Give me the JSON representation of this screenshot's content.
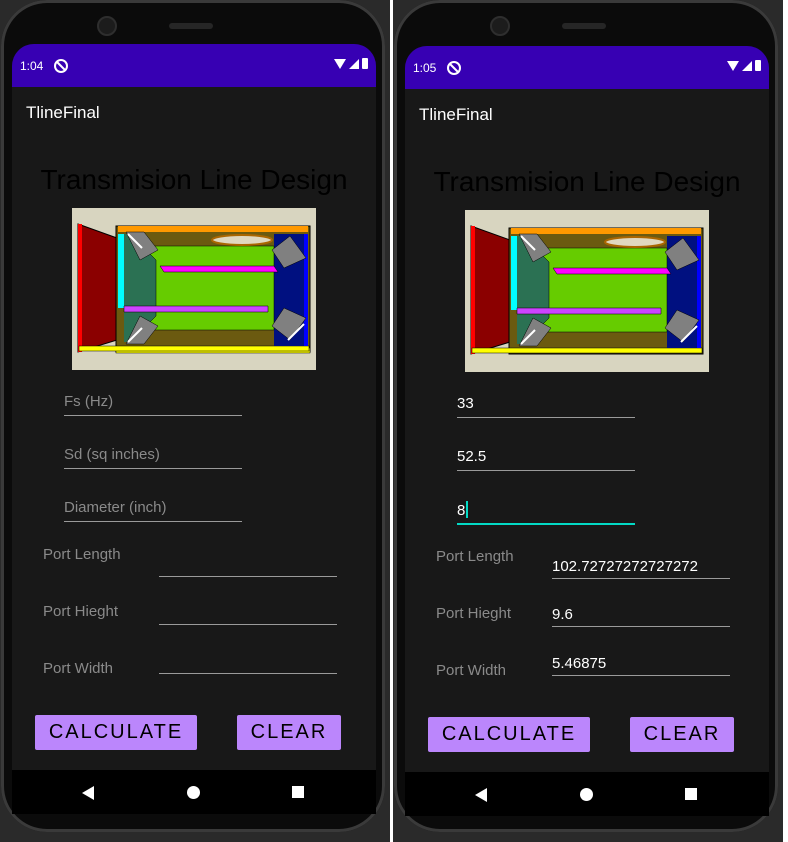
{
  "screens": [
    {
      "status_time": "1:04",
      "app_title": "TlineFinal",
      "heading": "Transmision Line Design",
      "inputs": {
        "fs": {
          "value": "",
          "placeholder": "Fs (Hz)"
        },
        "sd": {
          "value": "",
          "placeholder": "Sd (sq inches)"
        },
        "diameter": {
          "value": "",
          "placeholder": "Diameter (inch)"
        }
      },
      "outputs": {
        "port_length": {
          "label": "Port Length",
          "value": ""
        },
        "port_height": {
          "label": "Port Hieght",
          "value": ""
        },
        "port_width": {
          "label": "Port Width",
          "value": ""
        }
      },
      "buttons": {
        "calculate": "CALCULATE",
        "clear": "CLEAR"
      }
    },
    {
      "status_time": "1:05",
      "app_title": "TlineFinal",
      "heading": "Transmision Line Design",
      "inputs": {
        "fs": {
          "value": "33",
          "placeholder": "Fs (Hz)"
        },
        "sd": {
          "value": "52.5",
          "placeholder": "Sd (sq inches)"
        },
        "diameter": {
          "value": "8",
          "placeholder": "Diameter (inch)"
        }
      },
      "outputs": {
        "port_length": {
          "label": "Port Length",
          "value": "102.72727272727272"
        },
        "port_height": {
          "label": "Port Hieght",
          "value": "9.6"
        },
        "port_width": {
          "label": "Port Width",
          "value": "5.46875"
        }
      },
      "buttons": {
        "calculate": "CALCULATE",
        "clear": "CLEAR"
      }
    }
  ],
  "colors": {
    "status_bar": "#3700b3",
    "button": "#bb86fc",
    "accent": "#03dac5",
    "screen_bg": "#181818"
  },
  "icons": [
    "dnd-icon",
    "wifi-icon",
    "cell-signal-icon",
    "battery-icon",
    "back-icon",
    "home-icon",
    "recents-icon"
  ]
}
